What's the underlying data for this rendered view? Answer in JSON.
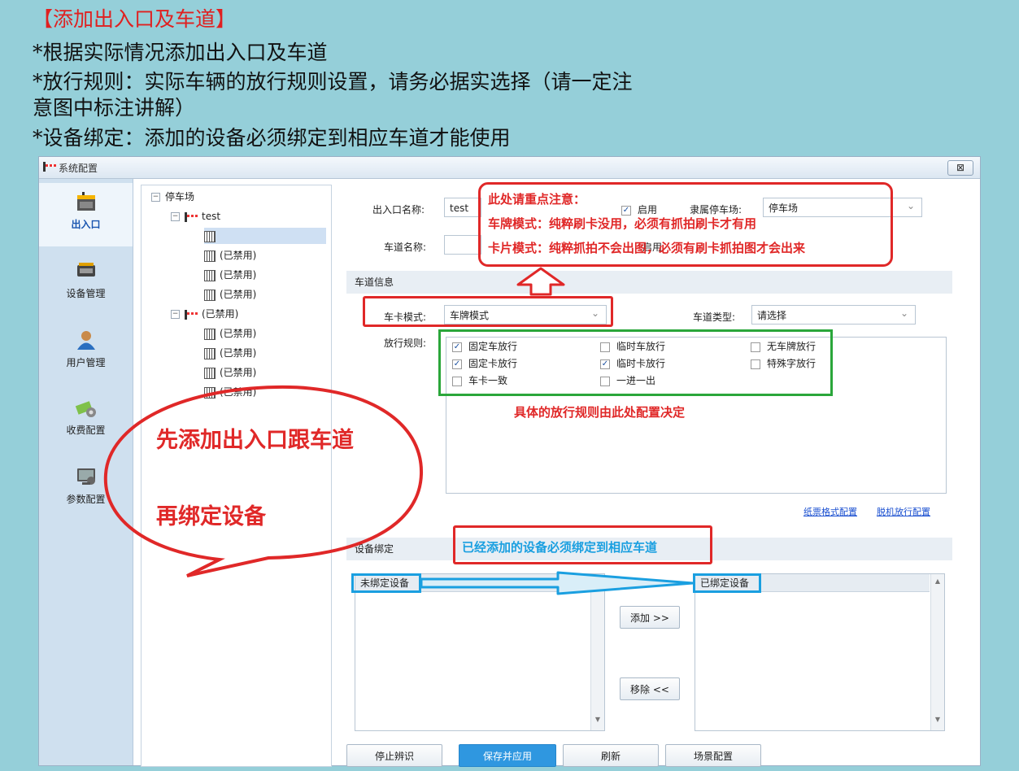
{
  "slide": {
    "title": "【添加出入口及车道】",
    "line1": "*根据实际情况添加出入口及车道",
    "line2": "*放行规则：实际车辆的放行规则设置，请务必据实选择（请一定注",
    "line3": "意图中标注讲解）",
    "line4": "*设备绑定：添加的设备必须绑定到相应车道才能使用"
  },
  "window": {
    "title": "系统配置",
    "close_label": "⊠"
  },
  "nav": {
    "items": [
      {
        "label": "出入口",
        "icon": "gate-icon"
      },
      {
        "label": "设备管理",
        "icon": "device-icon"
      },
      {
        "label": "用户管理",
        "icon": "user-icon"
      },
      {
        "label": "收费配置",
        "icon": "fee-icon"
      },
      {
        "label": "参数配置",
        "icon": "settings-icon"
      }
    ]
  },
  "tree": {
    "root": "停车场",
    "gate1": "test",
    "gate1_lanes": [
      "",
      "(已禁用)",
      "(已禁用)",
      "(已禁用)"
    ],
    "gate2": "(已禁用)",
    "gate2_lanes": [
      "(已禁用)",
      "(已禁用)",
      "(已禁用)",
      "(已禁用)"
    ]
  },
  "form": {
    "gate_name_label": "出入口名称:",
    "gate_name_value": "test",
    "enable_label": "启用",
    "parking_label": "隶属停车场:",
    "parking_value": "停车场",
    "lane_name_label": "车道名称:",
    "lane_name_value": "",
    "lane_enable_label": "启用",
    "lane_info_section": "车道信息",
    "card_mode_label": "车卡模式:",
    "card_mode_value": "车牌模式",
    "lane_type_label": "车道类型:",
    "lane_type_value": "请选择",
    "rules_label": "放行规则:",
    "rules": [
      {
        "label": "固定车放行",
        "checked": true
      },
      {
        "label": "临时车放行",
        "checked": false
      },
      {
        "label": "无车牌放行",
        "checked": false
      },
      {
        "label": "固定卡放行",
        "checked": true
      },
      {
        "label": "临时卡放行",
        "checked": true
      },
      {
        "label": "特殊字放行",
        "checked": false
      },
      {
        "label": "车卡一致",
        "checked": false
      },
      {
        "label": "一进一出",
        "checked": false
      }
    ],
    "link_ticket": "纸票格式配置",
    "link_offline": "脱机放行配置",
    "device_section": "设备绑定",
    "unbound_header": "未绑定设备",
    "bound_header": "已绑定设备",
    "add_button": "添加 >>",
    "remove_button": "移除 <<"
  },
  "footer": {
    "stop_button": "停止辨识",
    "save_button": "保存并应用",
    "refresh_button": "刷新",
    "scene_button": "场景配置"
  },
  "annotations": {
    "note_title": "此处请重点注意：",
    "note_plate": "车牌模式：纯粹刷卡没用，必须有抓拍刷卡才有用",
    "note_card": "卡片模式：纯粹抓拍不会出图，必须有刷卡抓拍图才会出来",
    "rules_note": "具体的放行规则由此处配置决定",
    "bubble_line1": "先添加出入口跟车道",
    "bubble_line2": "再绑定设备",
    "bind_note": "已经添加的设备必须绑定到相应车道"
  },
  "colors": {
    "annotation_red": "#e02828",
    "annotation_green": "#2aa63a",
    "annotation_blue": "#1a9fe0",
    "background": "#95cfd9"
  }
}
